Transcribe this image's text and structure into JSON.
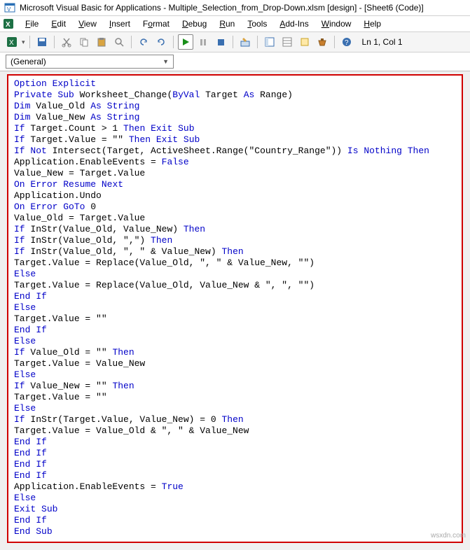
{
  "title": "Microsoft Visual Basic for Applications - Multiple_Selection_from_Drop-Down.xlsm [design] - [Sheet6 (Code)]",
  "menu": {
    "file": "File",
    "edit": "Edit",
    "view": "View",
    "insert": "Insert",
    "format": "Format",
    "debug": "Debug",
    "run": "Run",
    "tools": "Tools",
    "addins": "Add-Ins",
    "window": "Window",
    "help": "Help"
  },
  "status": "Ln 1, Col 1",
  "combo": {
    "value": "(General)"
  },
  "watermark": "wsxdn.com",
  "code": [
    {
      "t": "Option Explicit",
      "k": [
        "Option",
        "Explicit"
      ]
    },
    {
      "t": "Private Sub Worksheet_Change(ByVal Target As Range)",
      "k": [
        "Private",
        "Sub",
        "ByVal",
        "As"
      ]
    },
    {
      "t": "Dim Value_Old As String",
      "k": [
        "Dim",
        "As",
        "String"
      ]
    },
    {
      "t": "Dim Value_New As String",
      "k": [
        "Dim",
        "As",
        "String"
      ]
    },
    {
      "t": "If Target.Count > 1 Then Exit Sub",
      "k": [
        "If",
        "Then",
        "Exit",
        "Sub"
      ]
    },
    {
      "t": "If Target.Value = \"\" Then Exit Sub",
      "k": [
        "If",
        "Then",
        "Exit",
        "Sub"
      ]
    },
    {
      "t": "If Not Intersect(Target, ActiveSheet.Range(\"Country_Range\")) Is Nothing Then",
      "k": [
        "If",
        "Not",
        "Is",
        "Nothing",
        "Then"
      ]
    },
    {
      "t": "Application.EnableEvents = False",
      "k": [
        "False"
      ]
    },
    {
      "t": "Value_New = Target.Value",
      "k": []
    },
    {
      "t": "On Error Resume Next",
      "k": [
        "On",
        "Error",
        "Resume",
        "Next"
      ]
    },
    {
      "t": "Application.Undo",
      "k": []
    },
    {
      "t": "On Error GoTo 0",
      "k": [
        "On",
        "Error",
        "GoTo"
      ]
    },
    {
      "t": "Value_Old = Target.Value",
      "k": []
    },
    {
      "t": "If InStr(Value_Old, Value_New) Then",
      "k": [
        "If",
        "Then"
      ]
    },
    {
      "t": "If InStr(Value_Old, \",\") Then",
      "k": [
        "If",
        "Then"
      ]
    },
    {
      "t": "If InStr(Value_Old, \", \" & Value_New) Then",
      "k": [
        "If",
        "Then"
      ]
    },
    {
      "t": "Target.Value = Replace(Value_Old, \", \" & Value_New, \"\")",
      "k": []
    },
    {
      "t": "Else",
      "k": [
        "Else"
      ]
    },
    {
      "t": "Target.Value = Replace(Value_Old, Value_New & \", \", \"\")",
      "k": []
    },
    {
      "t": "End If",
      "k": [
        "End",
        "If"
      ]
    },
    {
      "t": "Else",
      "k": [
        "Else"
      ]
    },
    {
      "t": "Target.Value = \"\"",
      "k": []
    },
    {
      "t": "End If",
      "k": [
        "End",
        "If"
      ]
    },
    {
      "t": "Else",
      "k": [
        "Else"
      ]
    },
    {
      "t": "If Value_Old = \"\" Then",
      "k": [
        "If",
        "Then"
      ]
    },
    {
      "t": "Target.Value = Value_New",
      "k": []
    },
    {
      "t": "Else",
      "k": [
        "Else"
      ]
    },
    {
      "t": "If Value_New = \"\" Then",
      "k": [
        "If",
        "Then"
      ]
    },
    {
      "t": "Target.Value = \"\"",
      "k": []
    },
    {
      "t": "Else",
      "k": [
        "Else"
      ]
    },
    {
      "t": "If InStr(Target.Value, Value_New) = 0 Then",
      "k": [
        "If",
        "Then"
      ]
    },
    {
      "t": "Target.Value = Value_Old & \", \" & Value_New",
      "k": []
    },
    {
      "t": "End If",
      "k": [
        "End",
        "If"
      ]
    },
    {
      "t": "End If",
      "k": [
        "End",
        "If"
      ]
    },
    {
      "t": "End If",
      "k": [
        "End",
        "If"
      ]
    },
    {
      "t": "End If",
      "k": [
        "End",
        "If"
      ]
    },
    {
      "t": "Application.EnableEvents = True",
      "k": [
        "True"
      ]
    },
    {
      "t": "Else",
      "k": [
        "Else"
      ]
    },
    {
      "t": "Exit Sub",
      "k": [
        "Exit",
        "Sub"
      ]
    },
    {
      "t": "End If",
      "k": [
        "End",
        "If"
      ]
    },
    {
      "t": "End Sub",
      "k": [
        "End",
        "Sub"
      ]
    }
  ]
}
